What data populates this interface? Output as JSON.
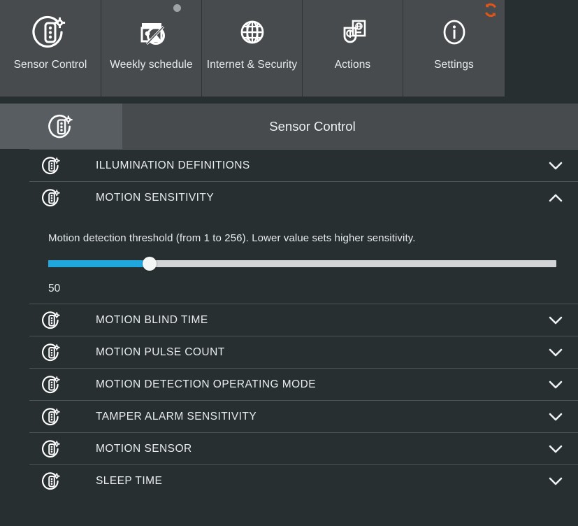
{
  "colors": {
    "page_bg": "#282f31",
    "tile_bg": "#474b4d",
    "titlebar_bg": "#474b4d",
    "titlebar_icon_bg": "#575d60",
    "accent_slider": "#20a8de",
    "slider_track": "#d2d4d5",
    "badge_refresh": "#e25518",
    "badge_dot": "#9ea3a5",
    "text": "#e9edee",
    "divider": "#4c5457"
  },
  "tabs": [
    {
      "label": "Sensor Control",
      "icon": "sensor-control-icon",
      "badge": "none"
    },
    {
      "label": "Weekly schedule",
      "icon": "weekly-schedule-disabled-icon",
      "badge": "dot"
    },
    {
      "label": "Internet & Security",
      "icon": "globe-icon",
      "badge": "none"
    },
    {
      "label": "Actions",
      "icon": "shield-actions-icon",
      "badge": "none"
    },
    {
      "label": "Settings",
      "icon": "info-icon",
      "badge": "refresh"
    }
  ],
  "titlebar": {
    "icon": "sensor-control-icon",
    "title": "Sensor Control"
  },
  "list": [
    {
      "label": "ILLUMINATION DEFINITIONS",
      "icon": "sensor-control-icon",
      "expanded": false,
      "chevron": "chevron-down-icon"
    },
    {
      "label": "MOTION SENSITIVITY",
      "icon": "sensor-control-icon",
      "expanded": true,
      "chevron": "chevron-up-icon"
    },
    {
      "label": "MOTION BLIND TIME",
      "icon": "sensor-control-icon",
      "expanded": false,
      "chevron": "chevron-down-icon"
    },
    {
      "label": "MOTION PULSE COUNT",
      "icon": "sensor-control-icon",
      "expanded": false,
      "chevron": "chevron-down-icon"
    },
    {
      "label": "MOTION DETECTION OPERATING MODE",
      "icon": "sensor-control-icon",
      "expanded": false,
      "chevron": "chevron-down-icon"
    },
    {
      "label": "TAMPER ALARM SENSITIVITY",
      "icon": "sensor-control-icon",
      "expanded": false,
      "chevron": "chevron-down-icon"
    },
    {
      "label": "MOTION SENSOR",
      "icon": "sensor-control-icon",
      "expanded": false,
      "chevron": "chevron-down-icon"
    },
    {
      "label": "SLEEP TIME",
      "icon": "sensor-control-icon",
      "expanded": false,
      "chevron": "chevron-down-icon"
    }
  ],
  "motion_sensitivity": {
    "description": "Motion detection threshold (from 1 to 256). Lower value sets higher sensitivity.",
    "value": "50",
    "min": 1,
    "max": 256,
    "fill_percent": 20
  }
}
